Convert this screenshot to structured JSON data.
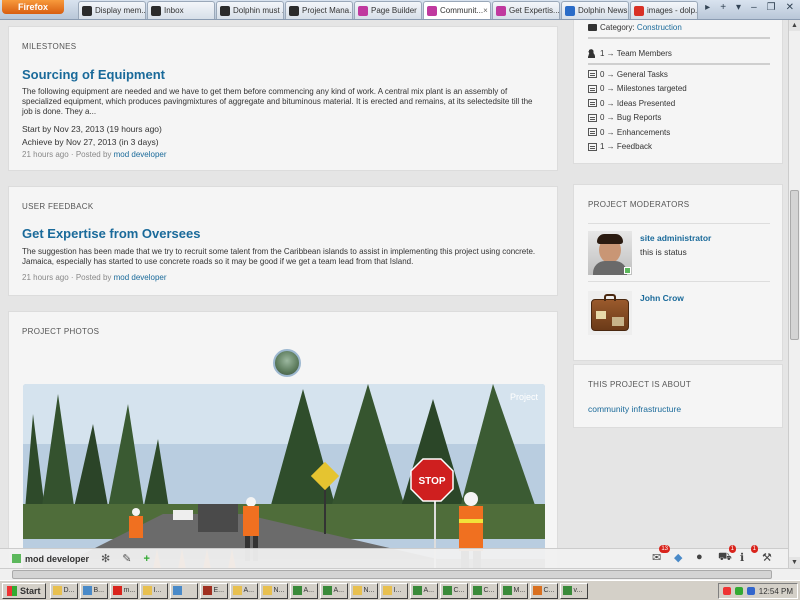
{
  "browser": {
    "app_button": "Firefox",
    "tabs": [
      {
        "label": "Display mem...",
        "color": "#2b2b2b"
      },
      {
        "label": "Inbox",
        "color": "#2b2b2b"
      },
      {
        "label": "Dolphin must ...",
        "color": "#2b2b2b"
      },
      {
        "label": "Project Mana...",
        "color": "#2b2b2b"
      },
      {
        "label": "Page Builder",
        "color": "#c0399f"
      },
      {
        "label": "Communit...",
        "color": "#c0399f",
        "active": true
      },
      {
        "label": "Get Expertis...",
        "color": "#c0399f"
      },
      {
        "label": "Dolphin News...",
        "color": "#2a6cc8"
      },
      {
        "label": "images - dolp...",
        "color": "#d93025"
      }
    ]
  },
  "milestones": {
    "heading": "MILESTONES",
    "title": "Sourcing of Equipment",
    "body": "The following equipment are needed and we have to get them before commencing any kind of work. A central mix plant is an assembly of specialized equipment, which produces pavingmixtures of aggregate and bituminous material. It is erected and remains, at its selectedsite till the job is done. They a...",
    "start": "Start by Nov 23, 2013 (19 hours ago)",
    "achieve": "Achieve by Nov 27, 2013 (in 3 days)",
    "meta_prefix": "21 hours ago · Posted by",
    "author": "mod developer"
  },
  "feedback": {
    "heading": "USER FEEDBACK",
    "title": "Get Expertise from Oversees",
    "body": "The suggestion has been made that we try to recruit some talent from the Caribbean islands to assist in implementing this project using concrete. Jamaica, especially has started to use concrete roads so it may be good if we get a team lead from that Island.",
    "meta_prefix": "21 hours ago · Posted by",
    "author": "mod developer"
  },
  "photos": {
    "heading": "PROJECT PHOTOS",
    "overlay_label": "Project"
  },
  "info": {
    "category_label": "Category:",
    "category_value": "Construction",
    "team": "1 → Team Members",
    "stats": [
      "0 → General Tasks",
      "0 → Milestones targeted",
      "0 → Ideas Presented",
      "0 → Bug Reports",
      "0 → Enhancements",
      "1 → Feedback"
    ]
  },
  "moderators": {
    "heading": "PROJECT MODERATORS",
    "items": [
      {
        "name": "site administrator",
        "status": "this is status"
      },
      {
        "name": "John Crow",
        "status": ""
      }
    ]
  },
  "about": {
    "heading": "THIS PROJECT IS ABOUT",
    "tag": "community infrastructure"
  },
  "dock": {
    "user": "mod developer",
    "badges": {
      "mail": "13",
      "cart": "1",
      "info": "1"
    }
  },
  "taskbar": {
    "start": "Start",
    "items": [
      "D...",
      "B...",
      "m...",
      "I...",
      "",
      "E...",
      "A...",
      "N...",
      "A...",
      "A...",
      "N...",
      "I...",
      "A...",
      "C...",
      "C...",
      "M...",
      "C...",
      "v..."
    ],
    "clock": "12:54 PM"
  }
}
